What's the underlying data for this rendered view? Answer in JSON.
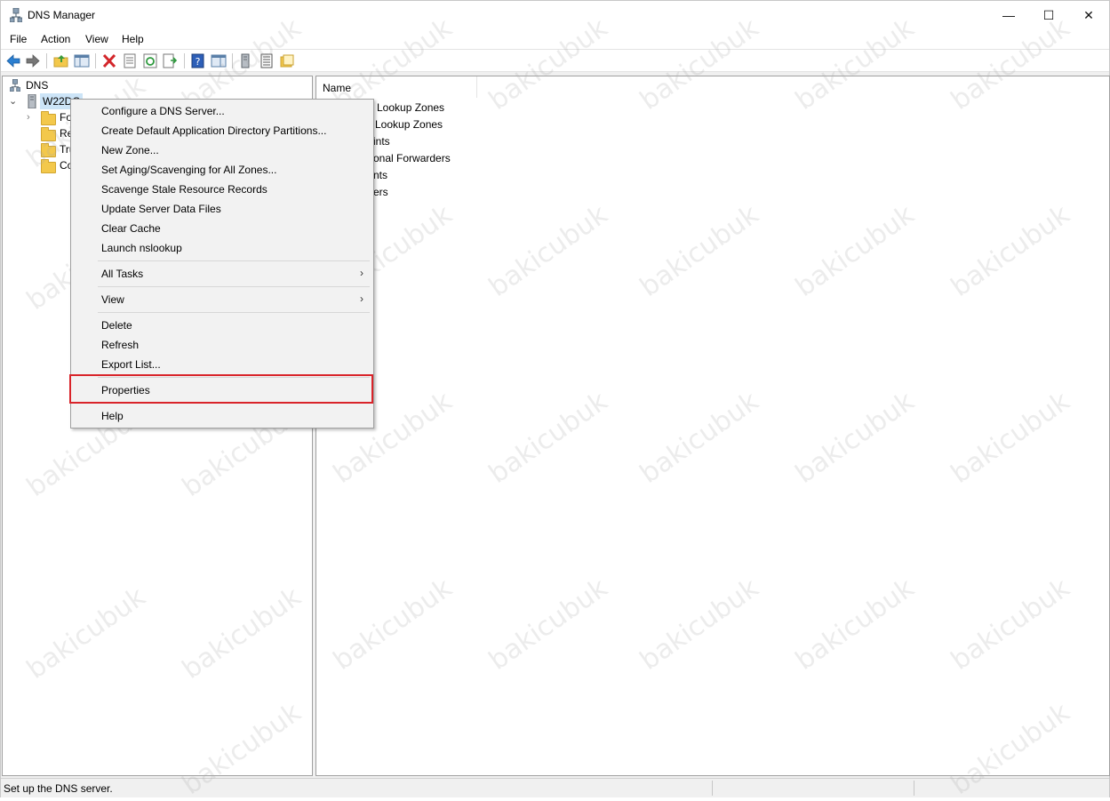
{
  "window": {
    "title": "DNS Manager",
    "controls": {
      "minimize": "—",
      "maximize": "☐",
      "close": "✕"
    }
  },
  "menubar": {
    "items": [
      "File",
      "Action",
      "View",
      "Help"
    ]
  },
  "toolbar": {
    "icons": [
      "back-arrow-icon",
      "forward-arrow-icon",
      "up-folder-icon",
      "show-console-tree-icon",
      "delete-icon",
      "properties-icon",
      "refresh-icon",
      "export-list-icon",
      "help-icon",
      "show-action-pane-icon",
      "server-icon",
      "list-icon",
      "folder-icon"
    ]
  },
  "tree": {
    "root": "DNS",
    "server": "W22DC",
    "children": [
      "Fo",
      "Re",
      "Tru",
      "Co"
    ]
  },
  "list": {
    "column_header": "Name",
    "items": [
      "Lookup Zones",
      "Lookup Zones",
      "ints",
      "onal Forwarders",
      "nts",
      "ers"
    ]
  },
  "context_menu": {
    "items": [
      "Configure a DNS Server...",
      "Create Default Application Directory Partitions...",
      "New Zone...",
      "Set Aging/Scavenging for All Zones...",
      "Scavenge Stale Resource Records",
      "Update Server Data Files",
      "Clear Cache",
      "Launch nslookup",
      "All Tasks",
      "View",
      "Delete",
      "Refresh",
      "Export List...",
      "Properties",
      "Help"
    ],
    "submenu_arrow": "›",
    "highlight_color": "#d9242a"
  },
  "statusbar": {
    "text": "Set up the DNS server."
  },
  "watermark": "bakicubuk"
}
